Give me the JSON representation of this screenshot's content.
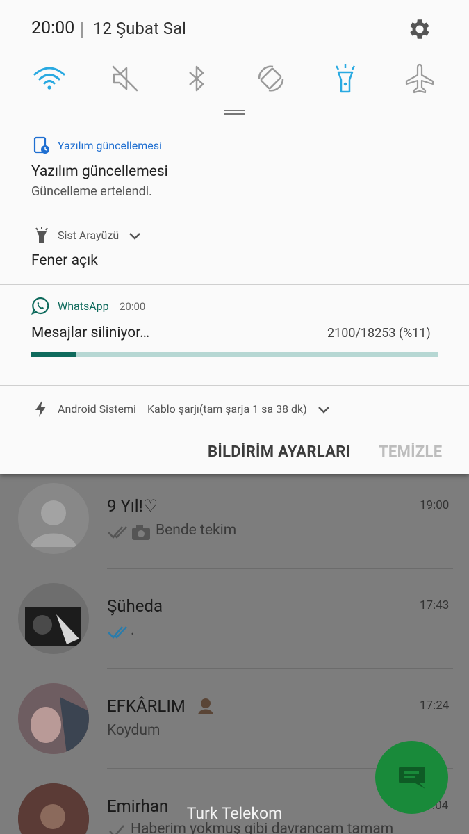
{
  "status": {
    "time": "20:00",
    "date": "12 Şubat Sal"
  },
  "quick_settings": [
    {
      "name": "wifi",
      "icon": "wifi-icon",
      "active": true
    },
    {
      "name": "sound",
      "icon": "mute-icon",
      "active": false
    },
    {
      "name": "bluetooth",
      "icon": "bluetooth-icon",
      "active": false
    },
    {
      "name": "rotation",
      "icon": "rotate-icon",
      "active": false
    },
    {
      "name": "flashlight",
      "icon": "flashlight-icon",
      "active": true
    },
    {
      "name": "airplane",
      "icon": "airplane-icon",
      "active": false
    }
  ],
  "notifications": {
    "update": {
      "app": "Yazılım güncellemesi",
      "title": "Yazılım güncellemesi",
      "text": "Güncelleme ertelendi."
    },
    "systemui": {
      "app": "Sist Arayüzü",
      "title": "Fener açık"
    },
    "whatsapp": {
      "app": "WhatsApp",
      "time": "20:00",
      "title": "Mesajlar siliniyor…",
      "progress_text": "2100/18253 (%11)",
      "progress": 0.11
    },
    "android": {
      "app": "Android Sistemi",
      "text": "Kablo şarjı(tam şarja 1 sa 38 dk)"
    }
  },
  "actions": {
    "settings_label": "BİLDİRİM AYARLARI",
    "clear_label": "TEMİZLE"
  },
  "chats": [
    {
      "name": "9 Yıl!♡",
      "time": "19:00",
      "message": "Bende tekim"
    },
    {
      "name": "Şüheda",
      "time": "17:43",
      "message": "."
    },
    {
      "name": "EFKÂRLIM",
      "time": "17:24",
      "message": "Koydum"
    },
    {
      "name": "Emirhan",
      "time": "17:04",
      "message": "Haberim yokmuş gibi davrancam tamam"
    }
  ],
  "carrier": "Turk Telekom",
  "colors": {
    "accent_blue": "#29a9e1",
    "whatsapp_green": "#0e6a5c",
    "link_blue": "#1f6fd1"
  }
}
